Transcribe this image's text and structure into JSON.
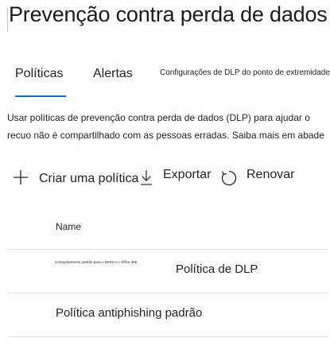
{
  "page": {
    "title": "Prevenção contra perda de dados"
  },
  "tabs": [
    {
      "label": "Políticas",
      "selected": true
    },
    {
      "label": "Alertas",
      "selected": false
    },
    {
      "label": "Configurações de DLP do ponto de extremidade",
      "selected": false
    }
  ],
  "description": {
    "line1": "Usar políticas de prevenção contra perda de dados (DLP) para ajudar o",
    "line2_text": "recuo não é compartilhado com as pessoas erradas. ",
    "learn_more": "Saiba mais em abade"
  },
  "toolbar": {
    "create_label": "Criar uma política",
    "export_label": "Exportar",
    "refresh_label": "Renovar",
    "icons": {
      "create": "plus-icon",
      "export": "download-icon",
      "refresh": "refresh-icon"
    }
  },
  "table": {
    "columns": [
      "Name"
    ],
    "rows": [
      {
        "note": "Comportamento padrão para o DKIM e o Office 365",
        "name": "Política de DLP"
      },
      {
        "note": "",
        "name": "Política antiphishing padrão"
      }
    ]
  },
  "colors": {
    "accent": "#0f6cbd",
    "text": "#242424",
    "divider": "#e1e1e1"
  }
}
